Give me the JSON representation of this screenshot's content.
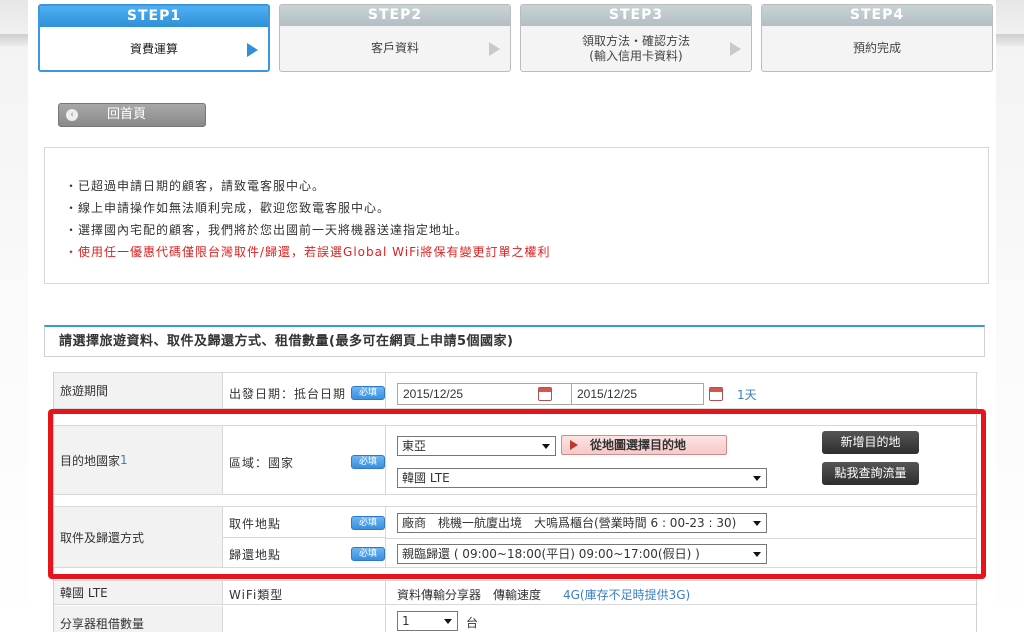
{
  "steps": [
    {
      "head": "STEP1",
      "label": "資費運算",
      "label2": ""
    },
    {
      "head": "STEP2",
      "label": "客戶資料",
      "label2": ""
    },
    {
      "head": "STEP3",
      "label": "領取方法・確認方法",
      "label2": "(輸入信用卡資料)"
    },
    {
      "head": "STEP4",
      "label": "預約完成",
      "label2": ""
    }
  ],
  "home_button": "回首頁",
  "notices": [
    "・已超過申請日期的顧客，請致電客服中心。",
    "・線上申請操作如無法順利完成，歡迎您致電客服中心。",
    "・選擇國內宅配的顧客，我們將於您出國前一天將機器送達指定地址。",
    "・使用任一優惠代碼僅限台灣取件/歸還，若誤選Global WiFi將保有變更訂單之權利"
  ],
  "section_title": "請選擇旅遊資料、取件及歸還方式、租借數量(最多可在網頁上申請5個國家)",
  "required": "必填",
  "travel": {
    "label": "旅遊期間",
    "sub": "出發日期：抵台日期",
    "start": "2015/12/25",
    "end": "2015/12/25",
    "days": "1天"
  },
  "destination": {
    "label": "目的地國家",
    "index": "1",
    "sub": "區域：國家",
    "region": "東亞",
    "country": "韓國 LTE",
    "map_button": "從地圖選擇目的地",
    "add_button": "新增目的地",
    "traffic_button": "點我查詢流量"
  },
  "pickup": {
    "label": "取件及歸還方式",
    "pickup_sub": "取件地點",
    "pickup_value": "廠商　桃機一航廈出境　大嗚爲櫃台(營業時間 6 : 00-23 : 30)",
    "return_sub": "歸還地點",
    "return_value": "親臨歸還 ( 09:00~18:00(平日) 09:00~17:00(假日) )"
  },
  "wifi": {
    "label": "韓國 LTE",
    "sub": "WiFi類型",
    "value": "資料傳輸分享器　傳輸速度",
    "speed": "4G(庫存不足時提供3G)"
  },
  "quantity": {
    "label": "分享器租借數量",
    "value": "1",
    "unit": "台"
  }
}
